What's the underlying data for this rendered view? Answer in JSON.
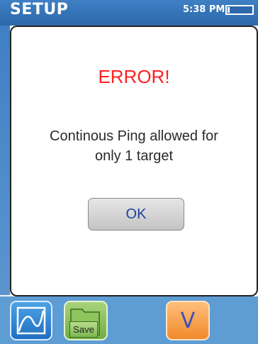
{
  "status_bar": {
    "title": "SETUP",
    "time": "5:38 PM",
    "battery_level": 0.1
  },
  "dialog": {
    "title": "ERROR!",
    "message_line1": "Continous Ping allowed for",
    "message_line2": "only 1 target",
    "ok_label": "OK"
  },
  "toolbar": {
    "graph_icon": "graph-icon",
    "save_label": "Save",
    "confirm_label": "V"
  },
  "colors": {
    "status_bar": "#2c68ab",
    "error_text": "#ff2020",
    "ok_text": "#1f3f9c",
    "toolbar": "#5e9cd4",
    "graph_button": "#1f6fc2",
    "save_button": "#6fae43",
    "confirm_button": "#f08a2c"
  }
}
